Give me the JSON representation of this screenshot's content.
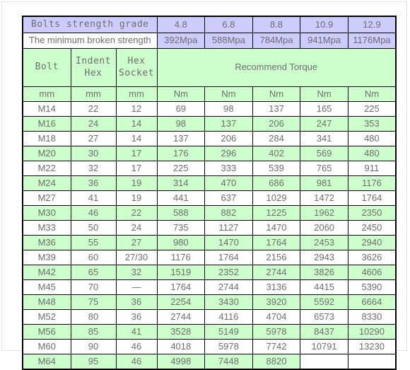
{
  "document": {
    "type": "bolt-torque-table",
    "colors": {
      "header_lavender": "#ccccff",
      "row_green": "#ccffcc",
      "row_white": "#ffffff",
      "text": "#6e6e6e",
      "border": "#000000",
      "page_background": "#ffffff"
    }
  },
  "header": {
    "grade_label": "Bolts strength grade",
    "grades": [
      "4.8",
      "6.8",
      "8.8",
      "10.9",
      "12.9"
    ],
    "broken_label": "The minimum broken strength",
    "broken_values": [
      "392Mpa",
      "588Mpa",
      "784Mpa",
      "941Mpa",
      "1176Mpa"
    ],
    "col_bolt": "Bolt",
    "col_indent_hex_line1": "Indent",
    "col_indent_hex_line2": "Hex",
    "col_hex_socket_line1": "Hex",
    "col_hex_socket_line2": "Socket",
    "recommend_torque": "Recommend Torque",
    "unit_bolt": "mm",
    "unit_indent": "mm",
    "unit_socket": "mm",
    "unit_torque": [
      "Nm",
      "Nm",
      "Nm",
      "Nm",
      "Nm"
    ]
  },
  "rows": [
    {
      "bolt": "M14",
      "indent_hex": "22",
      "hex_socket": "12",
      "torque": [
        "69",
        "98",
        "137",
        "165",
        "225"
      ],
      "shaded": false
    },
    {
      "bolt": "M16",
      "indent_hex": "24",
      "hex_socket": "14",
      "torque": [
        "98",
        "137",
        "206",
        "247",
        "353"
      ],
      "shaded": true
    },
    {
      "bolt": "M18",
      "indent_hex": "27",
      "hex_socket": "14",
      "torque": [
        "137",
        "206",
        "284",
        "341",
        "480"
      ],
      "shaded": false
    },
    {
      "bolt": "M20",
      "indent_hex": "30",
      "hex_socket": "17",
      "torque": [
        "176",
        "296",
        "402",
        "569",
        "480"
      ],
      "shaded": true
    },
    {
      "bolt": "M22",
      "indent_hex": "32",
      "hex_socket": "17",
      "torque": [
        "225",
        "333",
        "539",
        "765",
        "911"
      ],
      "shaded": false
    },
    {
      "bolt": "M24",
      "indent_hex": "36",
      "hex_socket": "19",
      "torque": [
        "314",
        "470",
        "686",
        "981",
        "1176"
      ],
      "shaded": true
    },
    {
      "bolt": "M27",
      "indent_hex": "41",
      "hex_socket": "19",
      "torque": [
        "441",
        "637",
        "1029",
        "1472",
        "1764"
      ],
      "shaded": false
    },
    {
      "bolt": "M30",
      "indent_hex": "46",
      "hex_socket": "22",
      "torque": [
        "588",
        "882",
        "1225",
        "1962",
        "2350"
      ],
      "shaded": true
    },
    {
      "bolt": "M33",
      "indent_hex": "50",
      "hex_socket": "24",
      "torque": [
        "735",
        "1127",
        "1470",
        "2060",
        "2450"
      ],
      "shaded": false
    },
    {
      "bolt": "M36",
      "indent_hex": "55",
      "hex_socket": "27",
      "torque": [
        "980",
        "1470",
        "1764",
        "2453",
        "2940"
      ],
      "shaded": true
    },
    {
      "bolt": "M39",
      "indent_hex": "60",
      "hex_socket": "27/30",
      "torque": [
        "1176",
        "1764",
        "2156",
        "2943",
        "3626"
      ],
      "shaded": false
    },
    {
      "bolt": "M42",
      "indent_hex": "65",
      "hex_socket": "32",
      "torque": [
        "1519",
        "2352",
        "2744",
        "3826",
        "4606"
      ],
      "shaded": true
    },
    {
      "bolt": "M45",
      "indent_hex": "70",
      "hex_socket": "—",
      "torque": [
        "1764",
        "2744",
        "3136",
        "4415",
        "5390"
      ],
      "shaded": false
    },
    {
      "bolt": "M48",
      "indent_hex": "75",
      "hex_socket": "36",
      "torque": [
        "2254",
        "3430",
        "3920",
        "5592",
        "6664"
      ],
      "shaded": true
    },
    {
      "bolt": "M52",
      "indent_hex": "80",
      "hex_socket": "36",
      "torque": [
        "2744",
        "4116",
        "4704",
        "6573",
        "8330"
      ],
      "shaded": false
    },
    {
      "bolt": "M56",
      "indent_hex": "85",
      "hex_socket": "41",
      "torque": [
        "3528",
        "5149",
        "5978",
        "8437",
        "10290"
      ],
      "shaded": true
    },
    {
      "bolt": "M60",
      "indent_hex": "90",
      "hex_socket": "46",
      "torque": [
        "4018",
        "5978",
        "7742",
        "10791",
        "13230"
      ],
      "shaded": false
    },
    {
      "bolt": "M64",
      "indent_hex": "95",
      "hex_socket": "46",
      "torque": [
        "4998",
        "7448",
        "8820",
        "",
        ""
      ],
      "shaded": true,
      "blank_tail": 2
    }
  ]
}
